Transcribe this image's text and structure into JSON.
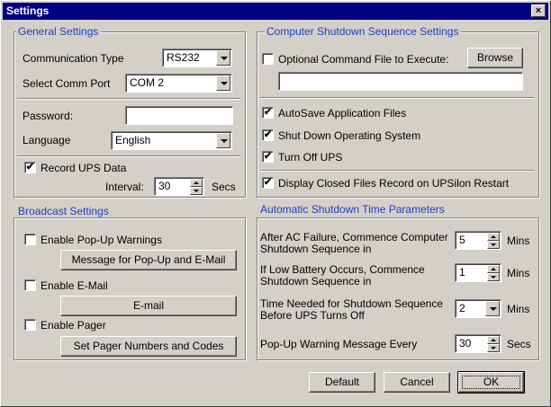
{
  "window": {
    "title": "Settings",
    "close_glyph": "×"
  },
  "general": {
    "title": "General Settings",
    "comm_type_label": "Communication Type",
    "comm_type_value": "RS232",
    "comm_port_label": "Select Comm Port",
    "comm_port_value": "COM 2",
    "password_label": "Password:",
    "password_value": "",
    "language_label": "Language",
    "language_value": "English",
    "record_label": "Record UPS Data",
    "record_checked": true,
    "interval_label": "Interval:",
    "interval_value": "30",
    "interval_unit": "Secs"
  },
  "shutdown": {
    "title": "Computer Shutdown Sequence Settings",
    "optional_cmd_label": "Optional Command File to Execute:",
    "optional_cmd_checked": false,
    "browse_label": "Browse",
    "cmd_file_value": "",
    "autosave_label": "AutoSave Application Files",
    "autosave_checked": true,
    "shutdown_os_label": "Shut Down Operating System",
    "shutdown_os_checked": true,
    "turnoff_label": "Turn Off UPS",
    "turnoff_checked": true,
    "display_closed_label": "Display Closed Files Record on UPSilon Restart",
    "display_closed_checked": true
  },
  "broadcast": {
    "title": "Broadcast Settings",
    "popup_label": "Enable Pop-Up Warnings",
    "popup_checked": false,
    "popup_msg_button": "Message for Pop-Up and E-Mail",
    "email_label": "Enable E-Mail",
    "email_checked": false,
    "email_button": "E-mail",
    "pager_label": "Enable Pager",
    "pager_checked": false,
    "pager_button": "Set Pager Numbers and Codes"
  },
  "auto_shutdown": {
    "title": "Automatic Shutdown Time Parameters",
    "ac_failure_label": "After AC Failure, Commence Computer Shutdown Sequence in",
    "ac_failure_value": "5",
    "ac_failure_unit": "Mins",
    "low_battery_label": "If Low Battery Occurs, Commence Shutdown Sequence in",
    "low_battery_value": "1",
    "low_battery_unit": "Mins",
    "time_needed_label": "Time Needed for Shutdown Sequence Before UPS Turns Off",
    "time_needed_value": "2",
    "time_needed_unit": "Mins",
    "popup_every_label": "Pop-Up Warning Message Every",
    "popup_every_value": "30",
    "popup_every_unit": "Secs"
  },
  "footer": {
    "default_label": "Default",
    "cancel_label": "Cancel",
    "ok_label": "OK"
  },
  "check_glyph": "✔"
}
